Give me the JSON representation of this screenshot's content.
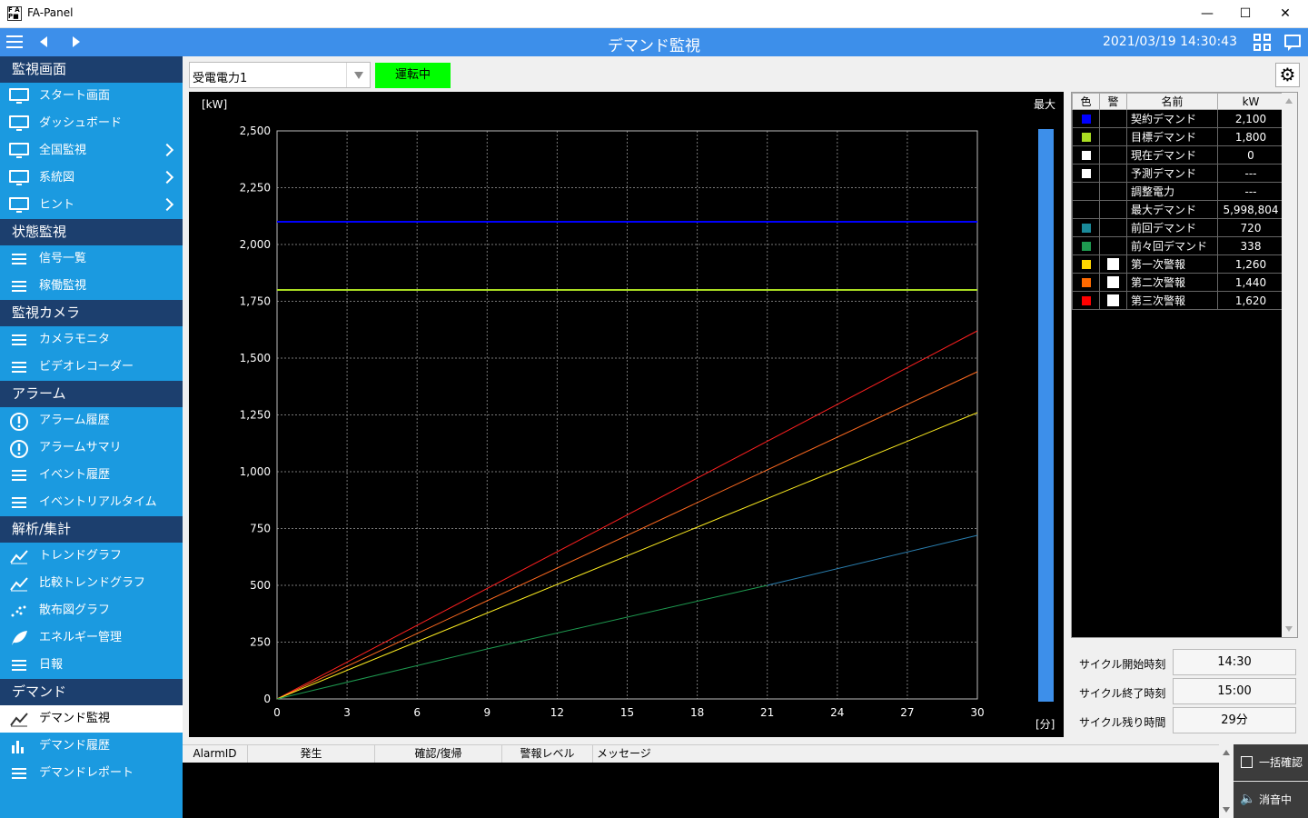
{
  "window": {
    "title": "FA-Panel",
    "minimize": "—",
    "maximize": "☐",
    "close": "✕"
  },
  "header": {
    "title": "デマンド監視",
    "datetime": "2021/03/19 14:30:43"
  },
  "sidebar": {
    "sections": [
      {
        "label": "監視画面",
        "items": [
          {
            "label": "スタート画面",
            "icon": "monitor-icon",
            "chevron": false
          },
          {
            "label": "ダッシュボード",
            "icon": "monitor-icon",
            "chevron": false
          },
          {
            "label": "全国監視",
            "icon": "monitor-icon",
            "chevron": true
          },
          {
            "label": "系統図",
            "icon": "monitor-icon",
            "chevron": true
          },
          {
            "label": "ヒント",
            "icon": "monitor-icon",
            "chevron": true
          }
        ]
      },
      {
        "label": "状態監視",
        "items": [
          {
            "label": "信号一覧",
            "icon": "list-icon",
            "chevron": false
          },
          {
            "label": "稼働監視",
            "icon": "operation-icon",
            "chevron": false
          }
        ]
      },
      {
        "label": "監視カメラ",
        "items": [
          {
            "label": "カメラモニタ",
            "icon": "camera-icon",
            "chevron": false
          },
          {
            "label": "ビデオレコーダー",
            "icon": "recorder-icon",
            "chevron": false
          }
        ]
      },
      {
        "label": "アラーム",
        "items": [
          {
            "label": "アラーム履歴",
            "icon": "alarm-history-icon",
            "chevron": false
          },
          {
            "label": "アラームサマリ",
            "icon": "alarm-summary-icon",
            "chevron": false
          },
          {
            "label": "イベント履歴",
            "icon": "event-history-icon",
            "chevron": false
          },
          {
            "label": "イベントリアルタイム",
            "icon": "event-realtime-icon",
            "chevron": false
          }
        ]
      },
      {
        "label": "解析/集計",
        "items": [
          {
            "label": "トレンドグラフ",
            "icon": "trend-icon",
            "chevron": false
          },
          {
            "label": "比較トレンドグラフ",
            "icon": "compare-trend-icon",
            "chevron": false
          },
          {
            "label": "散布図グラフ",
            "icon": "scatter-icon",
            "chevron": false
          },
          {
            "label": "エネルギー管理",
            "icon": "leaf-icon",
            "chevron": false
          },
          {
            "label": "日報",
            "icon": "report-icon",
            "chevron": false
          }
        ]
      },
      {
        "label": "デマンド",
        "items": [
          {
            "label": "デマンド監視",
            "icon": "demand-icon",
            "chevron": false,
            "active": true
          },
          {
            "label": "デマンド履歴",
            "icon": "bar-icon",
            "chevron": false
          },
          {
            "label": "デマンドレポート",
            "icon": "demand-report-icon",
            "chevron": false
          }
        ]
      }
    ]
  },
  "toolbar": {
    "source_value": "受電電力1",
    "status_label": "運転中",
    "status_color": "#00ff00"
  },
  "chart_data": {
    "type": "line",
    "ylabel": "[kW]",
    "xlabel": "[分]",
    "max_label": "最大",
    "xlim": [
      0,
      30
    ],
    "ylim": [
      0,
      2500
    ],
    "xticks": [
      0,
      3,
      6,
      9,
      12,
      15,
      18,
      21,
      24,
      27,
      30
    ],
    "yticks": [
      0,
      250,
      500,
      750,
      1000,
      1250,
      1500,
      1750,
      2000,
      2250,
      2500
    ],
    "ytick_labels": [
      "0",
      "250",
      "500",
      "750",
      "1,000",
      "1,250",
      "1,500",
      "1,750",
      "2,000",
      "2,250",
      "2,500"
    ],
    "grid": true,
    "series": [
      {
        "name": "契約デマンド",
        "color": "#0000ff",
        "x": [
          0,
          30
        ],
        "y": [
          2100,
          2100
        ]
      },
      {
        "name": "目標デマンド",
        "color": "#aadd22",
        "x": [
          0,
          30
        ],
        "y": [
          1800,
          1800
        ]
      },
      {
        "name": "第三次警報",
        "color": "#ff2020",
        "x": [
          0,
          30
        ],
        "y": [
          0,
          1620
        ]
      },
      {
        "name": "第二次警報",
        "color": "#ff6a20",
        "x": [
          0,
          30
        ],
        "y": [
          0,
          1440
        ]
      },
      {
        "name": "第一次警報",
        "color": "#ffee20",
        "x": [
          0,
          30
        ],
        "y": [
          0,
          1260
        ]
      },
      {
        "name": "前々回デマンド",
        "color": "#1e9a50",
        "x": [
          0,
          9,
          21
        ],
        "y": [
          0,
          220,
          500
        ]
      },
      {
        "name": "前回デマンド",
        "color": "#2a7fb0",
        "x": [
          21,
          30
        ],
        "y": [
          500,
          720
        ]
      }
    ],
    "max_bar_level": 1.0,
    "max_bar_color": "#3d8fea"
  },
  "legend": {
    "headers": [
      "色",
      "警",
      "名前",
      "kW"
    ],
    "rows": [
      {
        "color": "#0000ff",
        "alarm": false,
        "name": "契約デマンド",
        "kw": "2,100"
      },
      {
        "color": "#aadd22",
        "alarm": false,
        "name": "目標デマンド",
        "kw": "1,800"
      },
      {
        "color": "#ffffff",
        "alarm": false,
        "name": "現在デマンド",
        "kw": "0"
      },
      {
        "color": "#ffffff",
        "alarm": false,
        "name": "予測デマンド",
        "kw": "---"
      },
      {
        "color": "",
        "alarm": false,
        "name": "調整電力",
        "kw": "---"
      },
      {
        "color": "",
        "alarm": false,
        "name": "最大デマンド",
        "kw": "5,998,804"
      },
      {
        "color": "#1a8a9a",
        "alarm": false,
        "name": "前回デマンド",
        "kw": "720"
      },
      {
        "color": "#1e9a50",
        "alarm": false,
        "name": "前々回デマンド",
        "kw": "338"
      },
      {
        "color": "#ffd700",
        "alarm": true,
        "name": "第一次警報",
        "kw": "1,260"
      },
      {
        "color": "#ff6a00",
        "alarm": true,
        "name": "第二次警報",
        "kw": "1,440"
      },
      {
        "color": "#ff0000",
        "alarm": true,
        "name": "第三次警報",
        "kw": "1,620"
      }
    ]
  },
  "cycle": {
    "start_label": "サイクル開始時刻",
    "start_value": "14:30",
    "end_label": "サイクル終了時刻",
    "end_value": "15:00",
    "remain_label": "サイクル残り時間",
    "remain_value": "29分"
  },
  "alarm": {
    "columns": [
      "AlarmID",
      "発生",
      "確認/復帰",
      "警報レベル",
      "メッセージ"
    ],
    "ack_label": "一括確認",
    "mute_label": "消音中"
  }
}
